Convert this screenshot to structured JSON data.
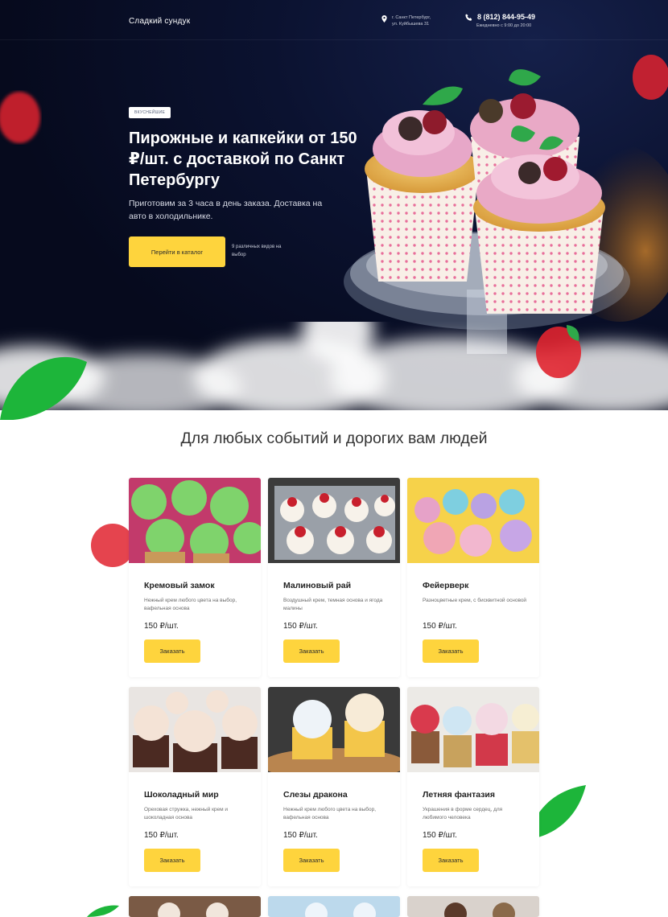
{
  "header": {
    "brand": "Сладкий сундук",
    "address_line1": "г. Санкт Петербург,",
    "address_line2": "ул. Куйбышева 31",
    "phone": "8 (812) 844-95-49",
    "hours": "Ежедневно с 9:00 до 20:00",
    "pin_icon": "map-pin-icon",
    "phone_icon": "phone-icon"
  },
  "hero": {
    "badge": "ВКУСНЕЙШИЕ",
    "title": "Пирожные и капкейки от 150 ₽/шт. с доставкой по Санкт Петербургу",
    "subtitle": "Приготовим за 3 часа в день заказа. Доставка на авто в холодильнике.",
    "cta_label": "Перейти в каталог",
    "cta_note": "9 различных видов на выбор"
  },
  "catalog": {
    "title": "Для любых событий и дорогих вам людей",
    "order_label": "Заказать",
    "products": [
      {
        "name": "Кремовый замок",
        "desc": "Нежный крем любого цвета на выбор, вафельная основа",
        "price": "150 ₽/шт."
      },
      {
        "name": "Малиновый рай",
        "desc": "Воздушный крем, темная основа и ягода малины",
        "price": "150 ₽/шт."
      },
      {
        "name": "Фейерверк",
        "desc": "Разноцветные крем, с бисквитной основой",
        "price": "150 ₽/шт."
      },
      {
        "name": "Шоколадный мир",
        "desc": "Ореховая стружка, нежный крем и шоколадная основа",
        "price": "150 ₽/шт."
      },
      {
        "name": "Слезы дракона",
        "desc": "Нежный крем любого цвета на выбор, вафельная основа",
        "price": "150 ₽/шт."
      },
      {
        "name": "Летняя фантазия",
        "desc": "Украшения в форме сердец, для любимого человека",
        "price": "150 ₽/шт."
      }
    ]
  },
  "colors": {
    "accent": "#fed43d",
    "hero_bg": "#0b1230",
    "text": "#222222"
  }
}
